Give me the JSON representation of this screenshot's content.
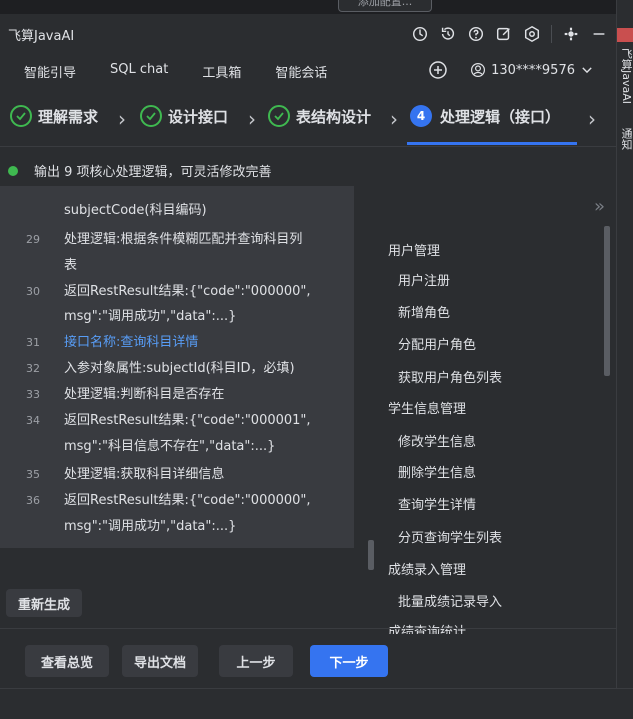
{
  "topstrip": {
    "pill_text": "添加配置..."
  },
  "app": {
    "title": "飞算JavaAI"
  },
  "nav": {
    "tabs": [
      "智能引导",
      "SQL chat",
      "工具箱",
      "智能会话"
    ],
    "user": "130****9576"
  },
  "steps": [
    {
      "label": "理解需求",
      "state": "done"
    },
    {
      "label": "设计接口",
      "state": "done"
    },
    {
      "label": "表结构设计",
      "state": "done"
    },
    {
      "label": "处理逻辑（接口）",
      "state": "active",
      "number": "4"
    }
  ],
  "status": {
    "text": "输出 9 项核心处理逻辑，可灵活修改完善"
  },
  "code_lines": [
    {
      "line": "",
      "text": "subjectCode(科目编码)"
    },
    {
      "line": "29",
      "text": "处理逻辑:根据条件模糊匹配并查询科目列"
    },
    {
      "line": "",
      "text": "表"
    },
    {
      "line": "30",
      "text": "返回RestResult结果:{\"code\":\"000000\","
    },
    {
      "line": "",
      "text": "msg\":\"调用成功\",\"data\":...}"
    },
    {
      "line": "31",
      "text": "接口名称:查询科目详情",
      "highlight": true
    },
    {
      "line": "32",
      "text": "入参对象属性:subjectId(科目ID，必填)"
    },
    {
      "line": "33",
      "text": "处理逻辑:判断科目是否存在"
    },
    {
      "line": "34",
      "text": "返回RestResult结果:{\"code\":\"000001\","
    },
    {
      "line": "",
      "text": "msg\":\"科目信息不存在\",\"data\":...}"
    },
    {
      "line": "35",
      "text": "处理逻辑:获取科目详细信息"
    },
    {
      "line": "36",
      "text": "返回RestResult结果:{\"code\":\"000000\","
    },
    {
      "line": "",
      "text": "msg\":\"调用成功\",\"data\":...}"
    }
  ],
  "outline": [
    {
      "text": "用户管理",
      "level": 0
    },
    {
      "text": "用户注册",
      "level": 1
    },
    {
      "text": "新增角色",
      "level": 1
    },
    {
      "text": "分配用户角色",
      "level": 1
    },
    {
      "text": "获取用户角色列表",
      "level": 1
    },
    {
      "text": "学生信息管理",
      "level": 0
    },
    {
      "text": "修改学生信息",
      "level": 1
    },
    {
      "text": "删除学生信息",
      "level": 1
    },
    {
      "text": "查询学生详情",
      "level": 1
    },
    {
      "text": "分页查询学生列表",
      "level": 1
    },
    {
      "text": "成绩录入管理",
      "level": 0
    },
    {
      "text": "批量成绩记录导入",
      "level": 1
    },
    {
      "text": "成绩查询统计",
      "level": 0
    }
  ],
  "rightbar": {
    "label1": "飞算JavaAI",
    "label2": "通知"
  },
  "buttons": {
    "regenerate": "重新生成",
    "overview": "查看总览",
    "export": "导出文档",
    "prev": "上一步",
    "next": "下一步"
  }
}
